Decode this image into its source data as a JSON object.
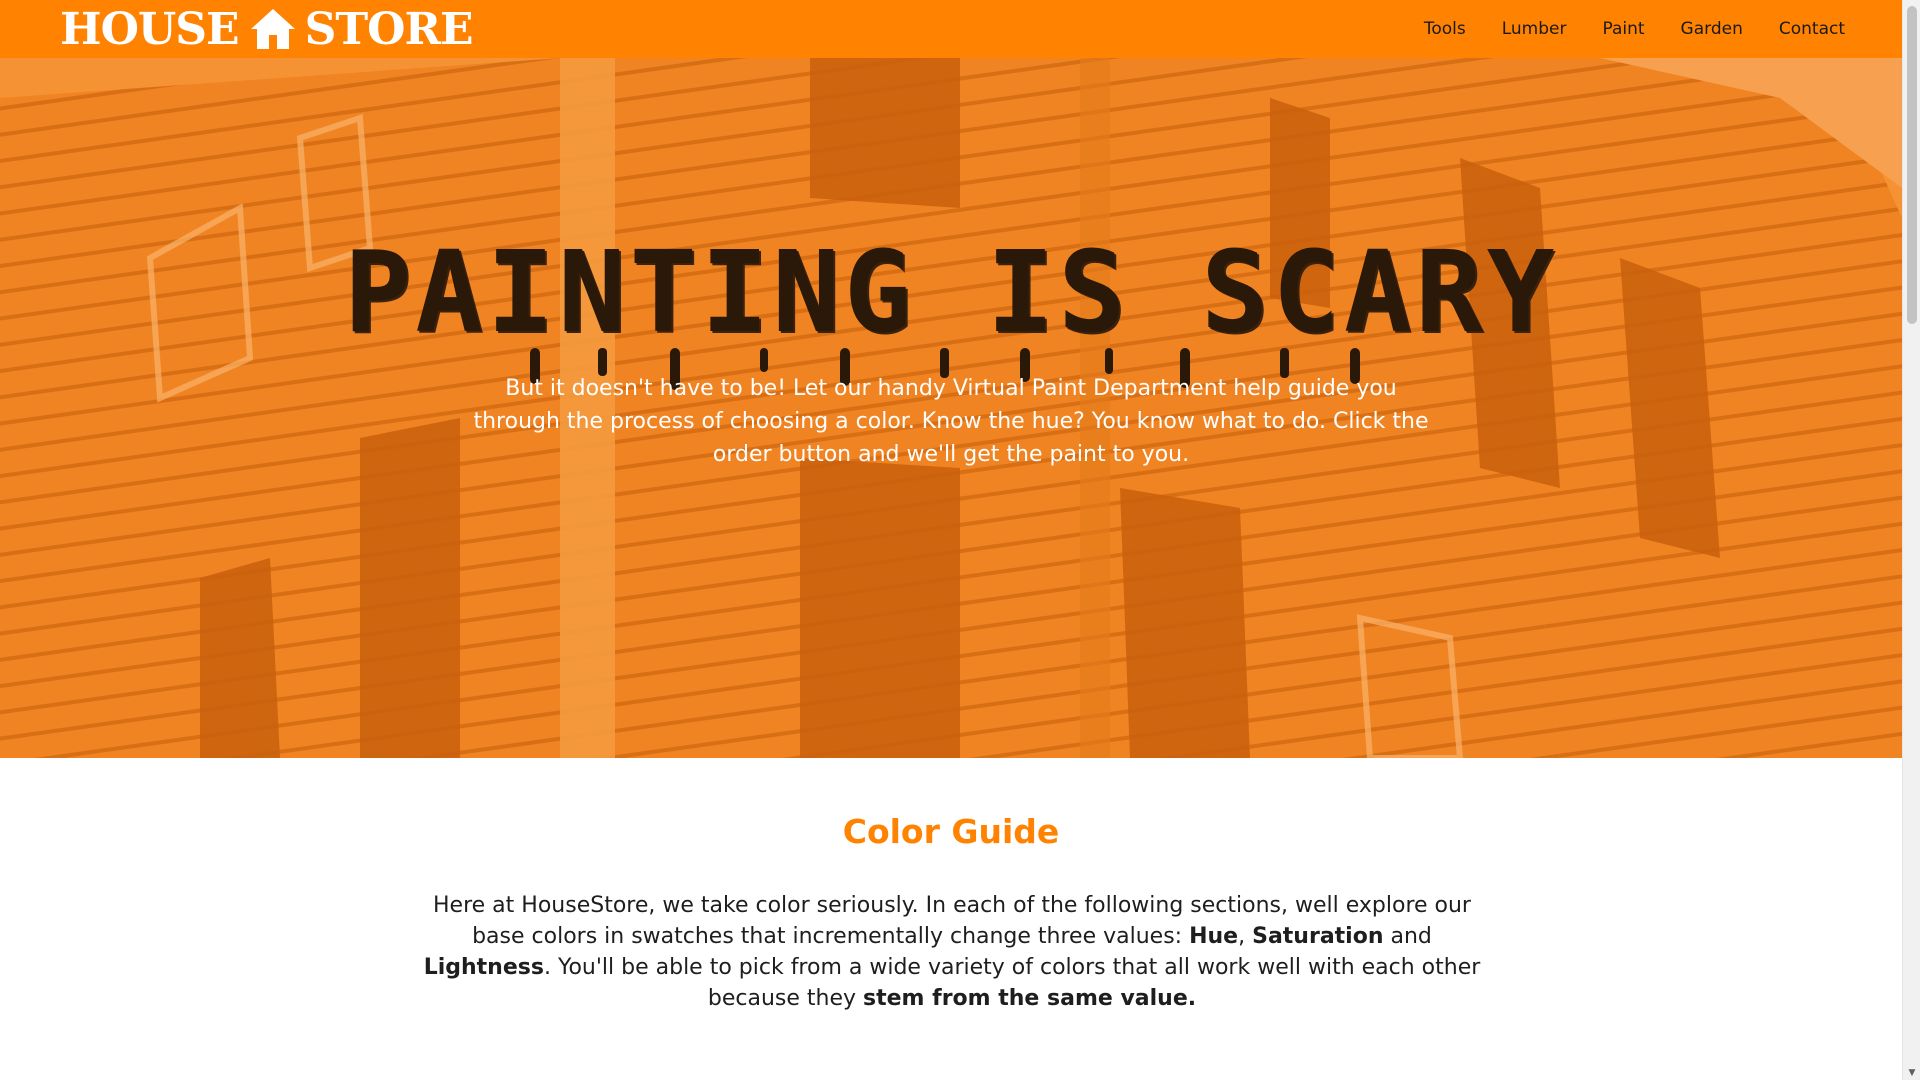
{
  "header": {
    "logo_left": "HOUSE",
    "logo_right": "STORE",
    "logo_icon": "house-icon",
    "nav": [
      "Tools",
      "Lumber",
      "Paint",
      "Garden",
      "Contact"
    ]
  },
  "hero": {
    "title": "PAINTING IS SCARY",
    "text": "But it doesn't have to be! Let our handy Virtual Paint Department help guide you through the process of choosing a color. Know the hue? You know what to do. Click the order button and we'll get the paint to you."
  },
  "guide": {
    "title": "Color Guide",
    "text_1": "Here at HouseStore, we take color seriously. In each of the following sections, well explore our base colors in swatches that incrementally change three values: ",
    "hue": "Hue",
    "comma": ", ",
    "saturation": "Saturation",
    "and": " and ",
    "lightness": "Lightness",
    "text_2": ". You'll be able to pick from a wide variety of colors that all work well with each other because they ",
    "stem": "stem from the same value."
  },
  "colors": {
    "brand_orange": "#ff8201",
    "hero_overlay": "#f58a1c",
    "title_dark": "#2a1808"
  }
}
